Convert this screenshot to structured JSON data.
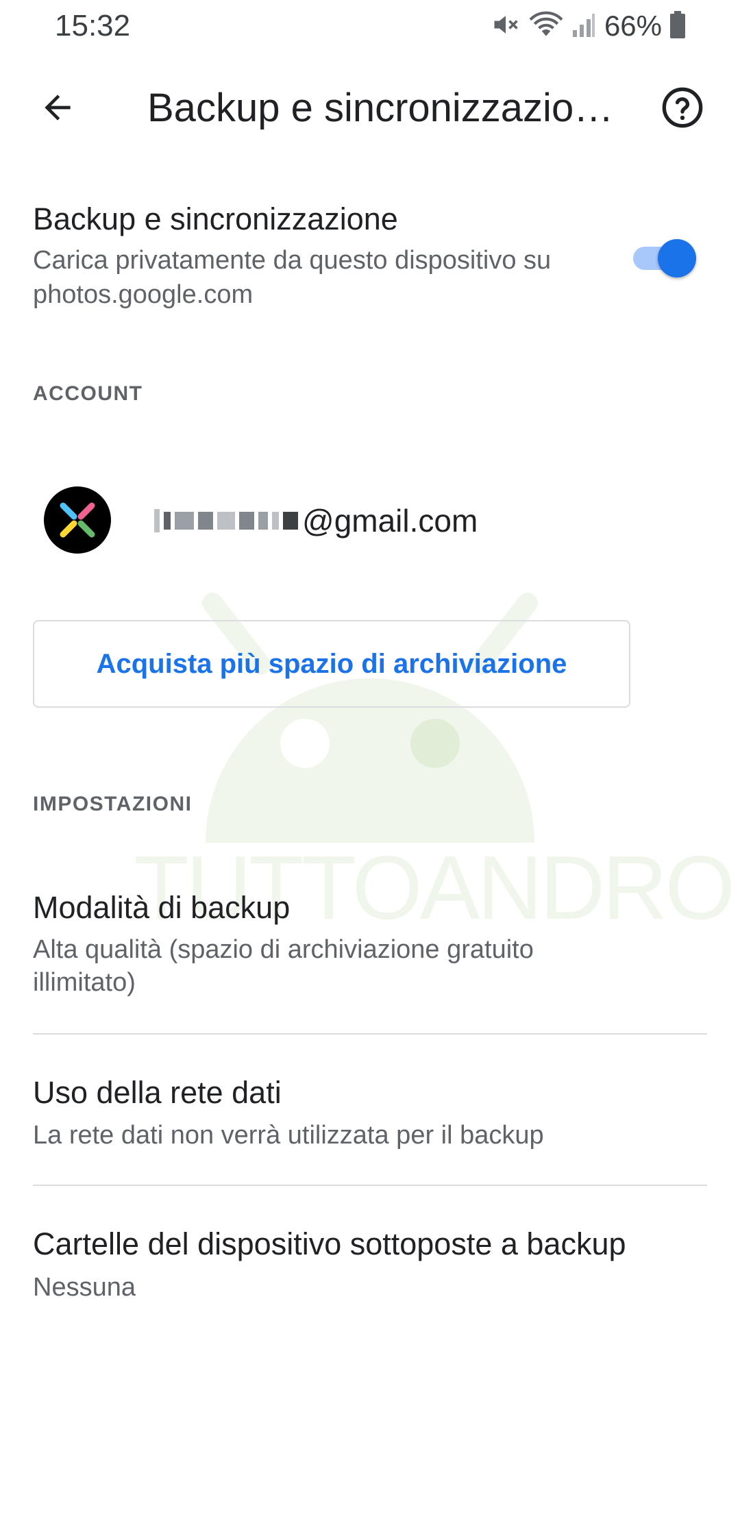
{
  "status_bar": {
    "time": "15:32",
    "battery_percent": "66%",
    "icons": [
      "mute-icon",
      "wifi-icon",
      "signal-icon",
      "battery-icon"
    ]
  },
  "app_bar": {
    "title": "Backup e sincronizzazio…",
    "back_icon": "arrow-back-icon",
    "help_icon": "help-icon"
  },
  "backup_toggle": {
    "title": "Backup e sincronizzazione",
    "description": "Carica privatamente da questo dispositivo su photos.google.com",
    "enabled": true
  },
  "account_section": {
    "header": "ACCOUNT",
    "email_domain": "@gmail.com",
    "buy_storage_label": "Acquista più spazio di archiviazione"
  },
  "settings_section": {
    "header": "IMPOSTAZIONI",
    "items": [
      {
        "title": "Modalità di backup",
        "description": "Alta qualità (spazio di archiviazione gratuito illimitato)"
      },
      {
        "title": "Uso della rete dati",
        "description": "La rete dati non verrà utilizzata per il backup"
      },
      {
        "title": "Cartelle del dispositivo sottoposte a backup",
        "description": "Nessuna"
      }
    ]
  },
  "watermark": {
    "text": "TUTTOANDROID"
  },
  "colors": {
    "accent": "#1a73e8",
    "switch_track": "#a8c7fa",
    "secondary_text": "#5f6368",
    "divider": "#dadce0"
  }
}
